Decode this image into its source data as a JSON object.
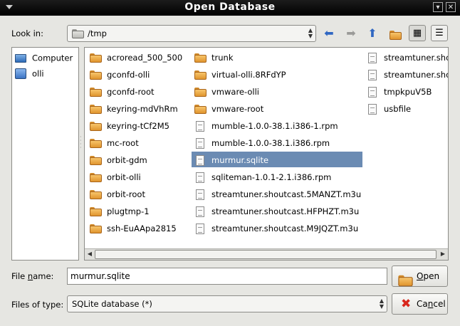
{
  "window": {
    "title": "Open Database"
  },
  "look_in": {
    "label": "Look in:",
    "path": "/tmp"
  },
  "toolbar": {
    "back_icon": "arrow-left-icon",
    "forward_icon": "arrow-right-icon",
    "up_icon": "arrow-up-icon",
    "new_folder_icon": "new-folder-icon",
    "icon_view_icon": "icon-view-icon",
    "detail_view_icon": "detail-view-icon"
  },
  "places": [
    {
      "label": "Computer",
      "icon": "computer-icon"
    },
    {
      "label": "olli",
      "icon": "home-folder-icon"
    }
  ],
  "files": {
    "columns": [
      [
        {
          "name": "acroread_500_500",
          "type": "folder"
        },
        {
          "name": "gconfd-olli",
          "type": "folder"
        },
        {
          "name": "gconfd-root",
          "type": "folder"
        },
        {
          "name": "keyring-mdVhRm",
          "type": "folder"
        },
        {
          "name": "keyring-tCf2M5",
          "type": "folder"
        },
        {
          "name": "mc-root",
          "type": "folder"
        },
        {
          "name": "orbit-gdm",
          "type": "folder"
        },
        {
          "name": "orbit-olli",
          "type": "folder"
        },
        {
          "name": "orbit-root",
          "type": "folder"
        },
        {
          "name": "plugtmp-1",
          "type": "folder"
        },
        {
          "name": "ssh-EuAApa2815",
          "type": "folder"
        }
      ],
      [
        {
          "name": "trunk",
          "type": "folder"
        },
        {
          "name": "virtual-olli.8RFdYP",
          "type": "folder"
        },
        {
          "name": "vmware-olli",
          "type": "folder"
        },
        {
          "name": "vmware-root",
          "type": "folder"
        },
        {
          "name": "mumble-1.0.0-38.1.i386-1.rpm",
          "type": "file"
        },
        {
          "name": "mumble-1.0.0-38.1.i386.rpm",
          "type": "file"
        },
        {
          "name": "murmur.sqlite",
          "type": "file",
          "selected": true
        },
        {
          "name": "sqliteman-1.0.1-2.1.i386.rpm",
          "type": "file"
        },
        {
          "name": "streamtuner.shoutcast.5MANZT.m3u",
          "type": "file"
        },
        {
          "name": "streamtuner.shoutcast.HFPHZT.m3u",
          "type": "file"
        },
        {
          "name": "streamtuner.shoutcast.M9JQZT.m3u",
          "type": "file"
        }
      ],
      [
        {
          "name": "streamtuner.sho",
          "type": "file"
        },
        {
          "name": "streamtuner.sho",
          "type": "file"
        },
        {
          "name": "tmpkpuV5B",
          "type": "file"
        },
        {
          "name": "usbfile",
          "type": "file"
        }
      ]
    ]
  },
  "file_name": {
    "label_prefix": "File ",
    "label_mnemonic": "n",
    "label_suffix": "ame:",
    "value": "murmur.sqlite"
  },
  "file_type": {
    "label": "Files of type:",
    "value": "SQLite database (*)"
  },
  "buttons": {
    "open_mnemonic": "O",
    "open_rest": "pen",
    "cancel_prefix": "Ca",
    "cancel_mnemonic": "n",
    "cancel_suffix": "cel"
  }
}
